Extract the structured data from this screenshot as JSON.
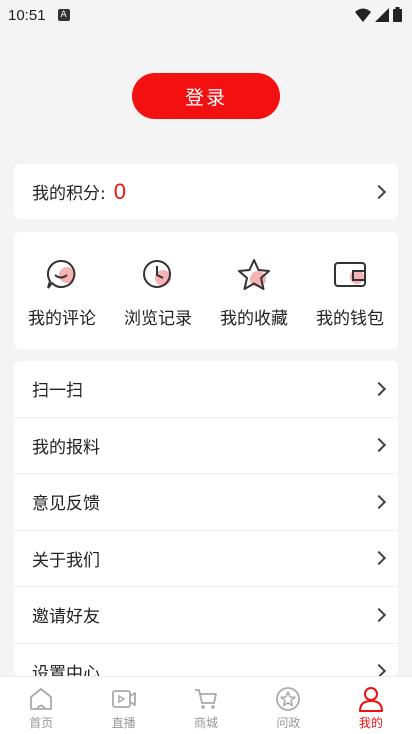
{
  "status": {
    "time": "10:51"
  },
  "login": {
    "label": "登录"
  },
  "points": {
    "label": "我的积分:",
    "value": "0"
  },
  "quick": [
    {
      "label": "我的评论",
      "icon": "comment-icon"
    },
    {
      "label": "浏览记录",
      "icon": "clock-icon"
    },
    {
      "label": "我的收藏",
      "icon": "star-icon"
    },
    {
      "label": "我的钱包",
      "icon": "wallet-icon"
    }
  ],
  "menu": [
    {
      "label": "扫一扫"
    },
    {
      "label": "我的报料"
    },
    {
      "label": "意见反馈"
    },
    {
      "label": "关于我们"
    },
    {
      "label": "邀请好友"
    },
    {
      "label": "设置中心"
    }
  ],
  "tabs": [
    {
      "label": "首页",
      "icon": "home-icon"
    },
    {
      "label": "直播",
      "icon": "live-icon"
    },
    {
      "label": "商城",
      "icon": "cart-icon"
    },
    {
      "label": "问政",
      "icon": "badge-star-icon"
    },
    {
      "label": "我的",
      "icon": "user-icon",
      "active": true
    }
  ],
  "colors": {
    "accent": "#f21010",
    "icon_pink": "#f6b3b3"
  }
}
